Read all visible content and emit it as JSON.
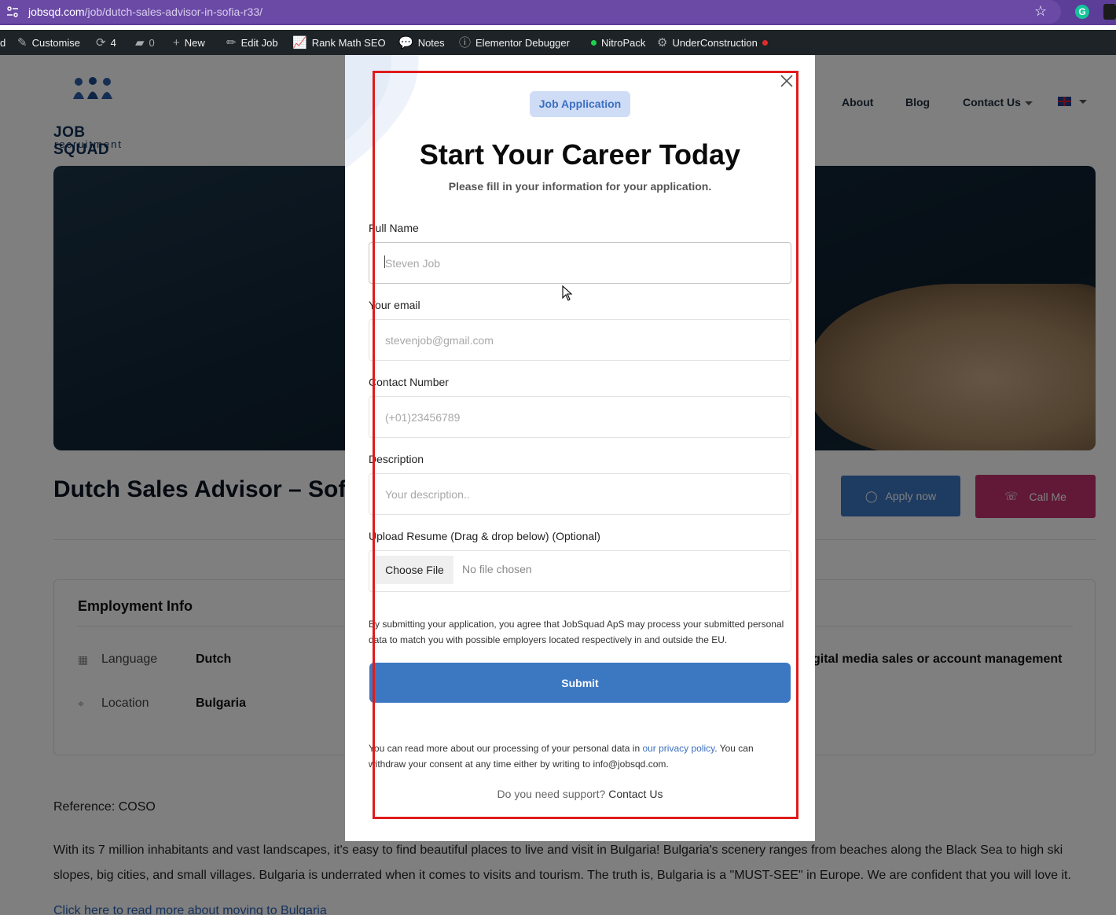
{
  "browser": {
    "url_domain": "jobsqd.com",
    "url_path": "/job/dutch-sales-advisor-in-sofia-r33/",
    "grammarly_badge": "G"
  },
  "admin_bar": {
    "cut_item": "d",
    "customise": "Customise",
    "updates_count": "4",
    "comments_count": "0",
    "new": "New",
    "edit_job": "Edit Job",
    "rank_math": "Rank Math SEO",
    "notes": "Notes",
    "elementor_debugger": "Elementor Debugger",
    "nitropack": "NitroPack",
    "under_construction": "UnderConstruction"
  },
  "site": {
    "logo_line1": "JOB SQUAD",
    "logo_line2": "recruitment",
    "nav": [
      "About",
      "Blog",
      "Contact Us"
    ],
    "job_title": "Dutch Sales Advisor – Sofia",
    "apply_label": "Apply now",
    "call_label": "Call Me",
    "employment_title": "Employment Info",
    "employment": [
      {
        "key": "Language",
        "value": "Dutch"
      },
      {
        "key": "Location",
        "value": "Bulgaria"
      }
    ],
    "employment_right": "gital media sales or account management",
    "reference": "Reference: COSO",
    "body_text": "With its 7 million inhabitants and vast landscapes, it's easy to find beautiful places to live and visit in Bulgaria! Bulgaria's scenery ranges from beaches along the Black Sea to high ski slopes, big cities, and small villages. Bulgaria is underrated when it comes to visits and tourism. The truth is, Bulgaria is a \"MUST-SEE\" in Europe. We are confident that you will love it.",
    "read_more_link": "Click here to read more about moving to Bulgaria"
  },
  "modal": {
    "badge": "Job Application",
    "title": "Start Your Career Today",
    "subtitle": "Please fill in your information for your application.",
    "full_name_label": "Full Name",
    "full_name_placeholder": "Steven Job",
    "email_label": "Your email",
    "email_placeholder": "stevenjob@gmail.com",
    "phone_label": "Contact Number",
    "phone_placeholder": "(+01)23456789",
    "description_label": "Description",
    "description_placeholder": "Your description..",
    "resume_label": "Upload Resume (Drag & drop below) (Optional)",
    "choose_file": "Choose File",
    "no_file": "No file chosen",
    "consent": "By submitting your application, you agree that JobSquad ApS may process your submitted personal data to match you with possible employers located respectively in and outside the EU.",
    "submit": "Submit",
    "privacy_pre": "You can read more about our processing of your personal data in ",
    "privacy_link": "our privacy policy",
    "privacy_post": ". You can withdraw your consent at any time either by writing to info@jobsqd.com.",
    "support_q": "Do you need support?",
    "support_link": "Contact Us"
  },
  "colors": {
    "accent_blue": "#3c77c2",
    "call_pink": "#c2336f",
    "annotation_red": "#e01b1b",
    "browser_purple": "#5c3d98"
  }
}
